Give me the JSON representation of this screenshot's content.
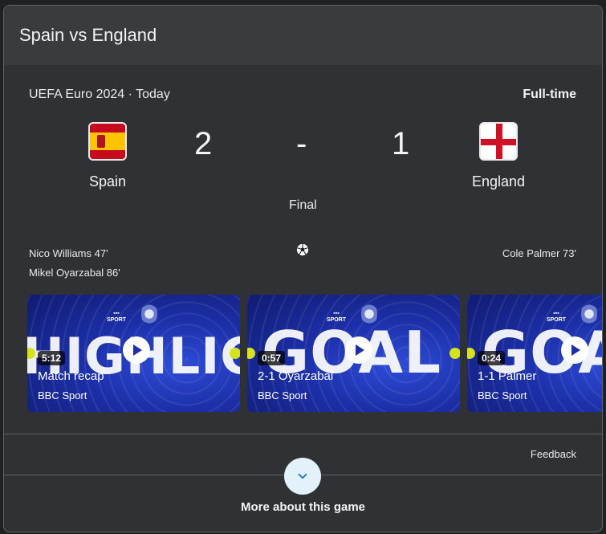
{
  "header": {
    "title": "Spain vs England"
  },
  "match": {
    "competition": "UEFA Euro 2024 · Today",
    "status": "Full-time",
    "final_label": "Final",
    "home": {
      "name": "Spain",
      "score": "2",
      "flag_icon": "spain-flag-icon"
    },
    "separator": "-",
    "away": {
      "name": "England",
      "score": "1",
      "flag_icon": "england-flag-icon"
    },
    "goals_home": [
      "Nico Williams 47'",
      "Mikel Oyarzabal 86'"
    ],
    "goals_away": [
      "Cole Palmer 73'"
    ]
  },
  "videos": [
    {
      "duration": "5:12",
      "title": "Match recap",
      "source": "BBC Sport",
      "overlay_text": "HIGHLIGHTS"
    },
    {
      "duration": "0:57",
      "title": "2-1 Oyarzabal",
      "source": "BBC Sport",
      "overlay_text": "GOAL"
    },
    {
      "duration": "0:24",
      "title": "1-1 Palmer",
      "source": "BBC Sport",
      "overlay_text": "GOAL"
    }
  ],
  "footer": {
    "feedback": "Feedback",
    "more_label": "More about this game"
  },
  "colors": {
    "background": "#202124",
    "card": "#303134",
    "header": "#3a3b3e",
    "video_blue": "#1c2fa8",
    "accent_button": "#e3f1fb"
  }
}
